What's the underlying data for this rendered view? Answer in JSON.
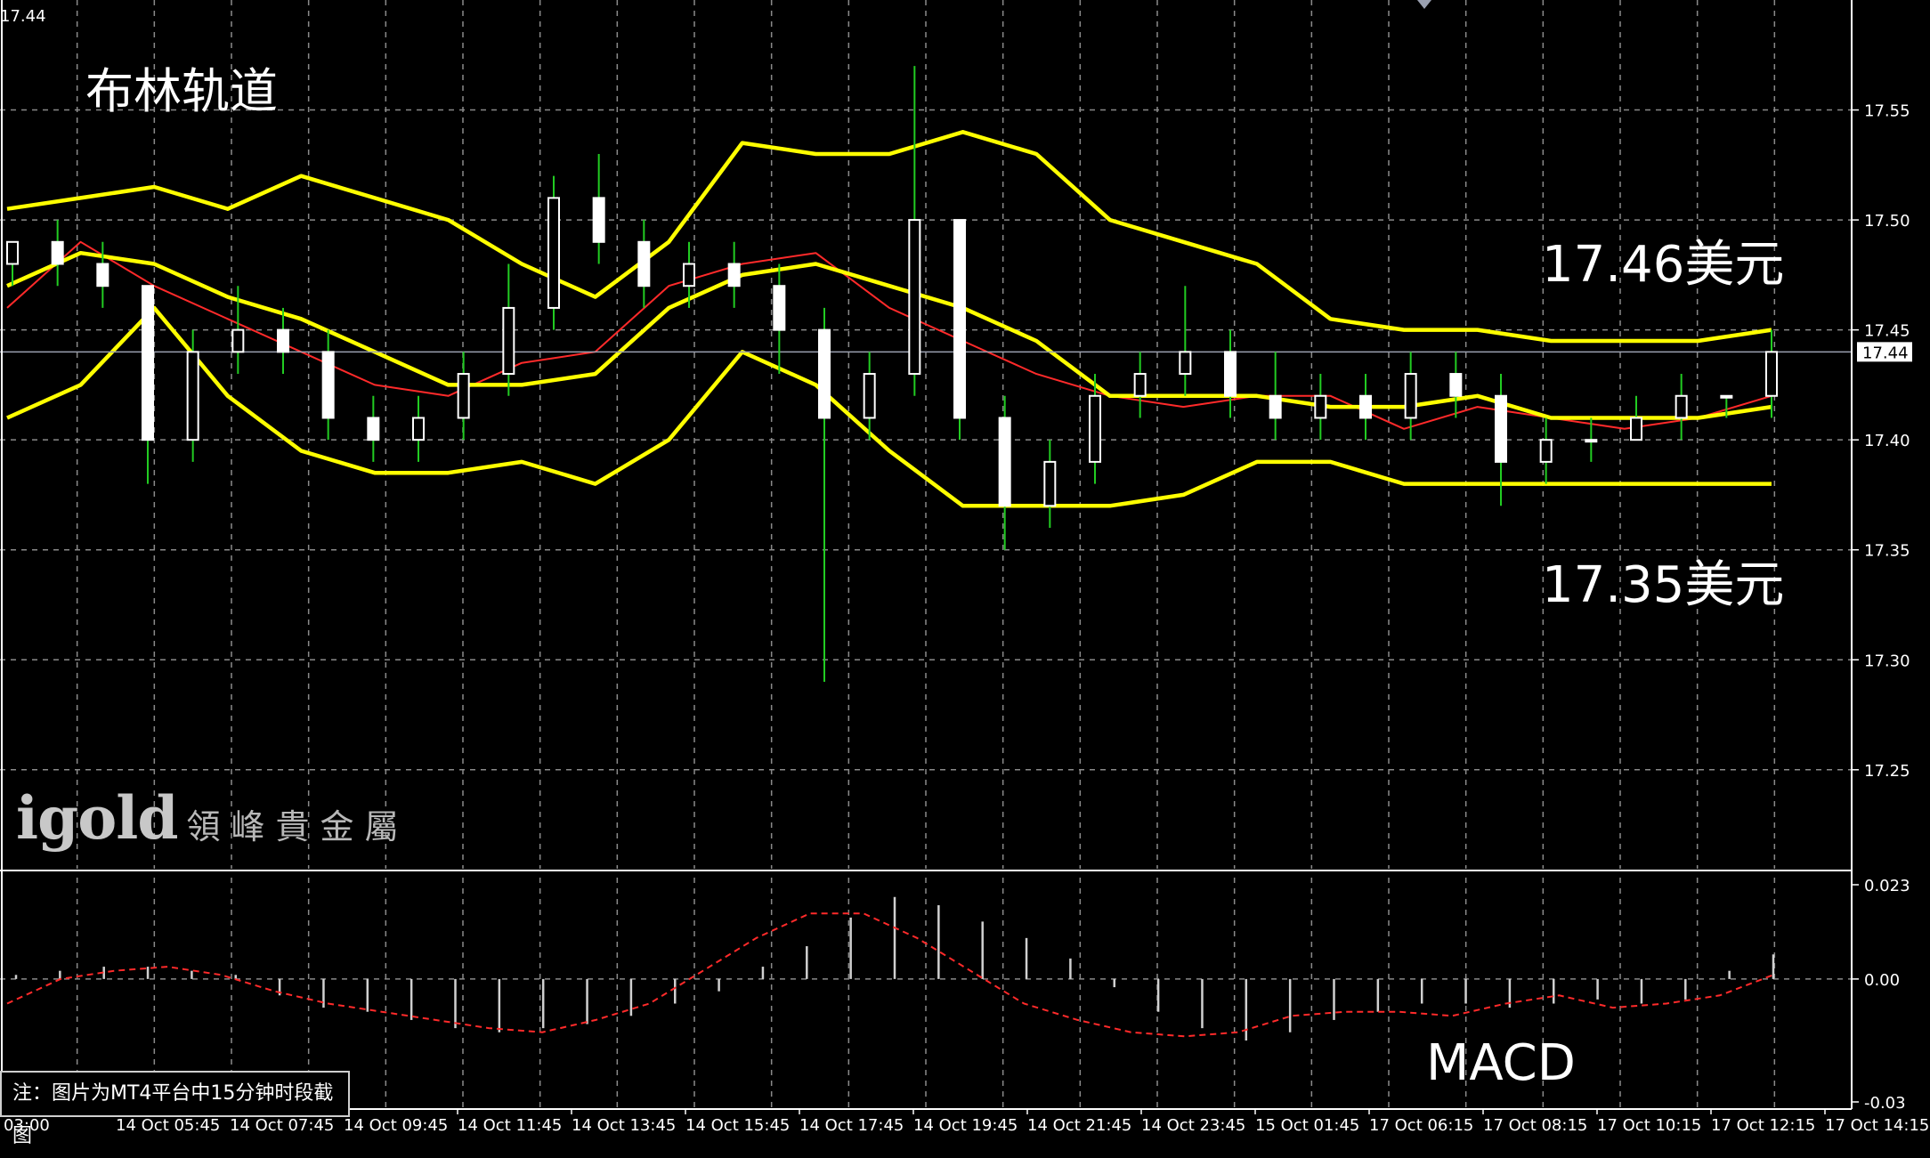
{
  "chart_data": [
    {
      "type": "candlestick",
      "title": "布林轨道",
      "timeframe_note": "注：图片为MT4平台中15分钟时段截图",
      "top_left_price": "17.44",
      "current_price": "17.44",
      "current_price_label": "17.44",
      "ylim": [
        17.205,
        17.6
      ],
      "y_ticks": [
        17.55,
        17.5,
        17.45,
        17.4,
        17.35,
        17.3,
        17.25
      ],
      "y_tick_labels": [
        "17.55",
        "17.50",
        "17.45",
        "17.40",
        "17.35",
        "17.30",
        "17.25"
      ],
      "x_tick_labels": [
        "03:00",
        "14 Oct 05:45",
        "14 Oct 07:45",
        "14 Oct 09:45",
        "14 Oct 11:45",
        "14 Oct 13:45",
        "14 Oct 15:45",
        "14 Oct 17:45",
        "14 Oct 19:45",
        "14 Oct 21:45",
        "14 Oct 23:45",
        "15 Oct 01:45",
        "17 Oct 06:15",
        "17 Oct 08:15",
        "17 Oct 10:15",
        "17 Oct 12:15",
        "17 Oct 14:15"
      ],
      "annotations": [
        {
          "text": "17.46美元",
          "price": 17.465
        },
        {
          "text": "17.35美元",
          "price": 17.35
        }
      ],
      "brand": {
        "name": "igold",
        "chinese": "領峰貴金屬"
      },
      "bollinger_upper": [
        17.505,
        17.51,
        17.515,
        17.505,
        17.52,
        17.51,
        17.5,
        17.48,
        17.465,
        17.49,
        17.535,
        17.53,
        17.53,
        17.54,
        17.53,
        17.5,
        17.49,
        17.48,
        17.455,
        17.45,
        17.45,
        17.445,
        17.445,
        17.445,
        17.45
      ],
      "bollinger_middle": [
        17.47,
        17.485,
        17.48,
        17.465,
        17.455,
        17.44,
        17.425,
        17.425,
        17.43,
        17.46,
        17.475,
        17.48,
        17.47,
        17.46,
        17.445,
        17.42,
        17.42,
        17.42,
        17.415,
        17.415,
        17.42,
        17.41,
        17.41,
        17.41,
        17.415
      ],
      "bollinger_lower": [
        17.41,
        17.425,
        17.46,
        17.42,
        17.395,
        17.385,
        17.385,
        17.39,
        17.38,
        17.4,
        17.44,
        17.425,
        17.395,
        17.37,
        17.37,
        17.37,
        17.375,
        17.39,
        17.39,
        17.38,
        17.38,
        17.38,
        17.38,
        17.38,
        17.38
      ],
      "moving_average": [
        17.46,
        17.49,
        17.47,
        17.455,
        17.44,
        17.425,
        17.42,
        17.435,
        17.44,
        17.47,
        17.48,
        17.485,
        17.46,
        17.445,
        17.43,
        17.42,
        17.415,
        17.42,
        17.42,
        17.405,
        17.415,
        17.41,
        17.405,
        17.41,
        17.42
      ],
      "candles": [
        [
          17.48,
          17.49,
          17.47,
          17.49
        ],
        [
          17.49,
          17.5,
          17.47,
          17.48
        ],
        [
          17.48,
          17.49,
          17.46,
          17.47
        ],
        [
          17.47,
          17.47,
          17.38,
          17.4
        ],
        [
          17.4,
          17.45,
          17.39,
          17.44
        ],
        [
          17.44,
          17.47,
          17.43,
          17.45
        ],
        [
          17.45,
          17.46,
          17.43,
          17.44
        ],
        [
          17.44,
          17.45,
          17.4,
          17.41
        ],
        [
          17.41,
          17.42,
          17.39,
          17.4
        ],
        [
          17.4,
          17.42,
          17.39,
          17.41
        ],
        [
          17.41,
          17.44,
          17.4,
          17.43
        ],
        [
          17.43,
          17.48,
          17.42,
          17.46
        ],
        [
          17.46,
          17.52,
          17.45,
          17.51
        ],
        [
          17.51,
          17.53,
          17.48,
          17.49
        ],
        [
          17.49,
          17.5,
          17.46,
          17.47
        ],
        [
          17.47,
          17.49,
          17.46,
          17.48
        ],
        [
          17.48,
          17.49,
          17.46,
          17.47
        ],
        [
          17.47,
          17.48,
          17.43,
          17.45
        ],
        [
          17.45,
          17.46,
          17.29,
          17.41
        ],
        [
          17.41,
          17.44,
          17.4,
          17.43
        ],
        [
          17.43,
          17.57,
          17.42,
          17.5
        ],
        [
          17.5,
          17.5,
          17.4,
          17.41
        ],
        [
          17.41,
          17.42,
          17.35,
          17.37
        ],
        [
          17.37,
          17.4,
          17.36,
          17.39
        ],
        [
          17.39,
          17.43,
          17.38,
          17.42
        ],
        [
          17.42,
          17.44,
          17.41,
          17.43
        ],
        [
          17.43,
          17.47,
          17.42,
          17.44
        ],
        [
          17.44,
          17.45,
          17.41,
          17.42
        ],
        [
          17.42,
          17.44,
          17.4,
          17.41
        ],
        [
          17.41,
          17.43,
          17.4,
          17.42
        ],
        [
          17.42,
          17.43,
          17.4,
          17.41
        ],
        [
          17.41,
          17.44,
          17.4,
          17.43
        ],
        [
          17.43,
          17.44,
          17.41,
          17.42
        ],
        [
          17.42,
          17.43,
          17.37,
          17.39
        ],
        [
          17.39,
          17.41,
          17.38,
          17.4
        ],
        [
          17.4,
          17.41,
          17.39,
          17.4
        ],
        [
          17.4,
          17.42,
          17.4,
          17.41
        ],
        [
          17.41,
          17.43,
          17.4,
          17.42
        ],
        [
          17.42,
          17.42,
          17.41,
          17.42
        ],
        [
          17.42,
          17.45,
          17.41,
          17.44
        ]
      ],
      "macd_panel": {
        "label": "MACD",
        "y_tick_labels": [
          "0.023",
          "0.00",
          "-0.03"
        ],
        "ylim": [
          -0.03,
          0.023
        ],
        "histogram": [
          0.001,
          0.002,
          0.003,
          0.003,
          0.002,
          0.001,
          -0.004,
          -0.007,
          -0.008,
          -0.01,
          -0.012,
          -0.013,
          -0.012,
          -0.011,
          -0.009,
          -0.006,
          -0.003,
          0.003,
          0.008,
          0.015,
          0.02,
          0.018,
          0.014,
          0.01,
          0.005,
          -0.002,
          -0.008,
          -0.012,
          -0.015,
          -0.013,
          -0.01,
          -0.008,
          -0.006,
          -0.006,
          -0.007,
          -0.006,
          -0.005,
          -0.006,
          -0.005,
          0.002,
          0.006
        ],
        "signal": [
          -0.006,
          0.0,
          0.002,
          0.003,
          0.001,
          -0.003,
          -0.006,
          -0.008,
          -0.01,
          -0.012,
          -0.013,
          -0.01,
          -0.006,
          0.002,
          0.01,
          0.016,
          0.016,
          0.01,
          0.002,
          -0.006,
          -0.01,
          -0.013,
          -0.014,
          -0.013,
          -0.009,
          -0.008,
          -0.008,
          -0.009,
          -0.006,
          -0.004,
          -0.007,
          -0.006,
          -0.004,
          0.001
        ]
      }
    }
  ],
  "colors": {
    "background": "#000000",
    "grid": "#8a8a8a",
    "bollinger": "#ffff00",
    "moving_average": "#ff2a2a",
    "candle_body": "#ffffff",
    "candle_wick": "#22cc22",
    "macd_histogram": "#d0d0d0",
    "macd_signal": "#ff2a2a"
  }
}
